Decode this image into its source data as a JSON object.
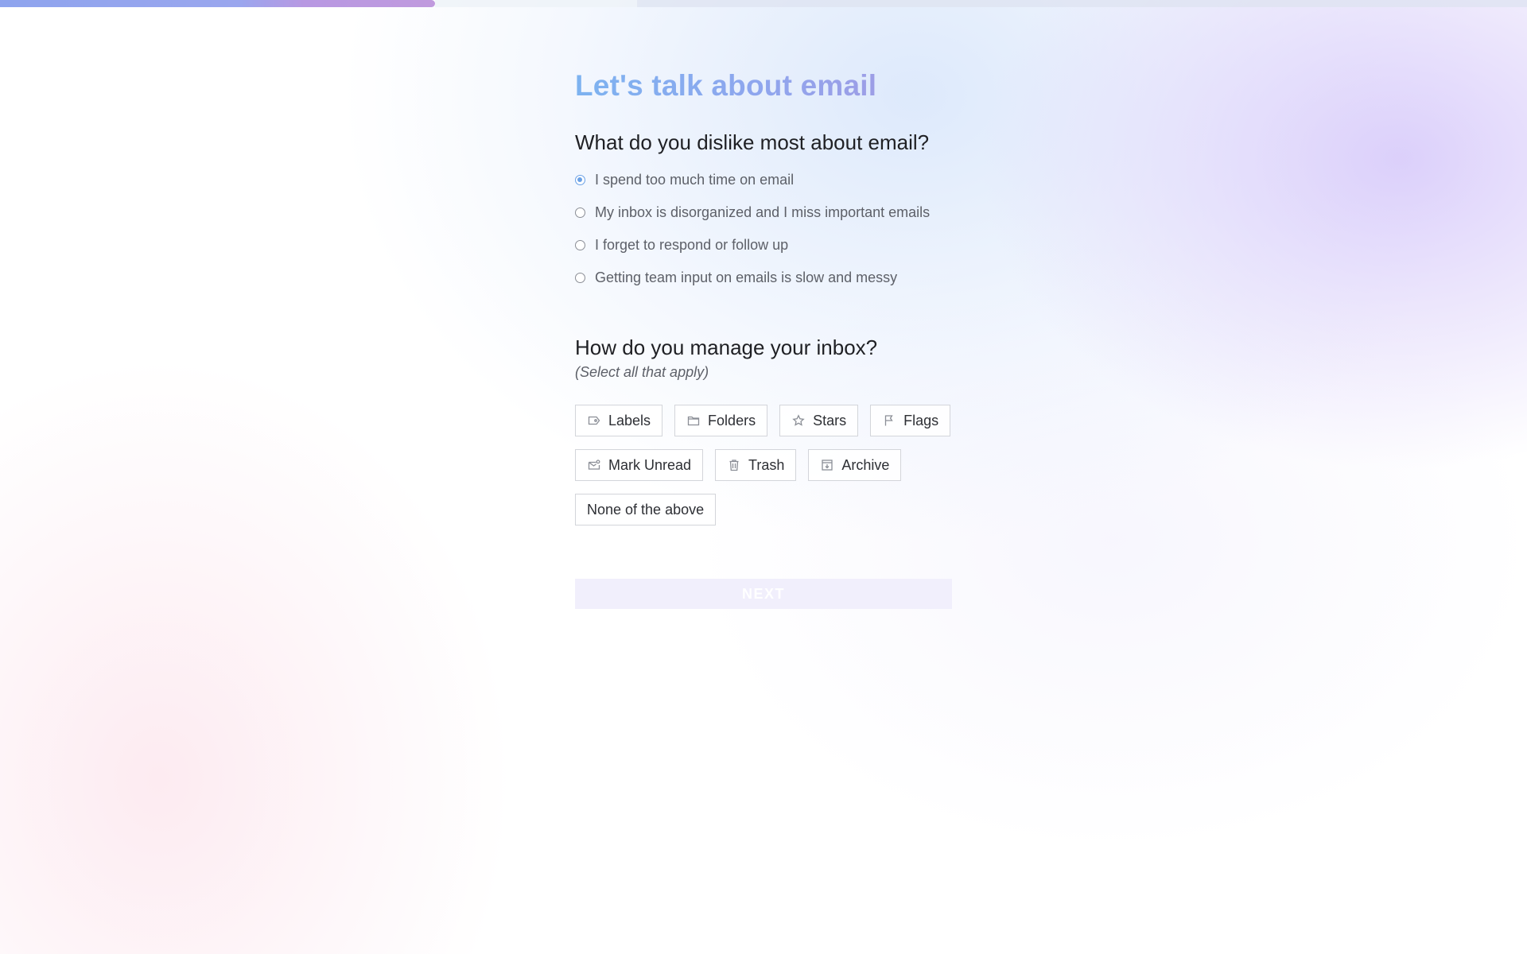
{
  "progress": {
    "fraction": 0.285
  },
  "title": "Let's talk about email",
  "question1": {
    "text": "What do you dislike most about email?",
    "options": [
      {
        "label": "I spend too much time on email",
        "checked": true
      },
      {
        "label": "My inbox is disorganized and I miss important emails",
        "checked": false
      },
      {
        "label": "I forget to respond or follow up",
        "checked": false
      },
      {
        "label": "Getting team input on emails is slow and messy",
        "checked": false
      }
    ]
  },
  "question2": {
    "text": "How do you manage your inbox?",
    "hint": "(Select all that apply)",
    "options": [
      {
        "label": "Labels",
        "icon": "label-icon"
      },
      {
        "label": "Folders",
        "icon": "folder-icon"
      },
      {
        "label": "Stars",
        "icon": "star-icon"
      },
      {
        "label": "Flags",
        "icon": "flag-icon"
      },
      {
        "label": "Mark Unread",
        "icon": "mark-unread-icon"
      },
      {
        "label": "Trash",
        "icon": "trash-icon"
      },
      {
        "label": "Archive",
        "icon": "archive-icon"
      },
      {
        "label": "None of the above",
        "icon": ""
      }
    ]
  },
  "next_button": "NEXT",
  "colors": {
    "accent": "#6aa1e6",
    "progress_start": "#8ea4ee",
    "progress_end": "#c09ade",
    "next_disabled_bg": "#f1effc"
  }
}
